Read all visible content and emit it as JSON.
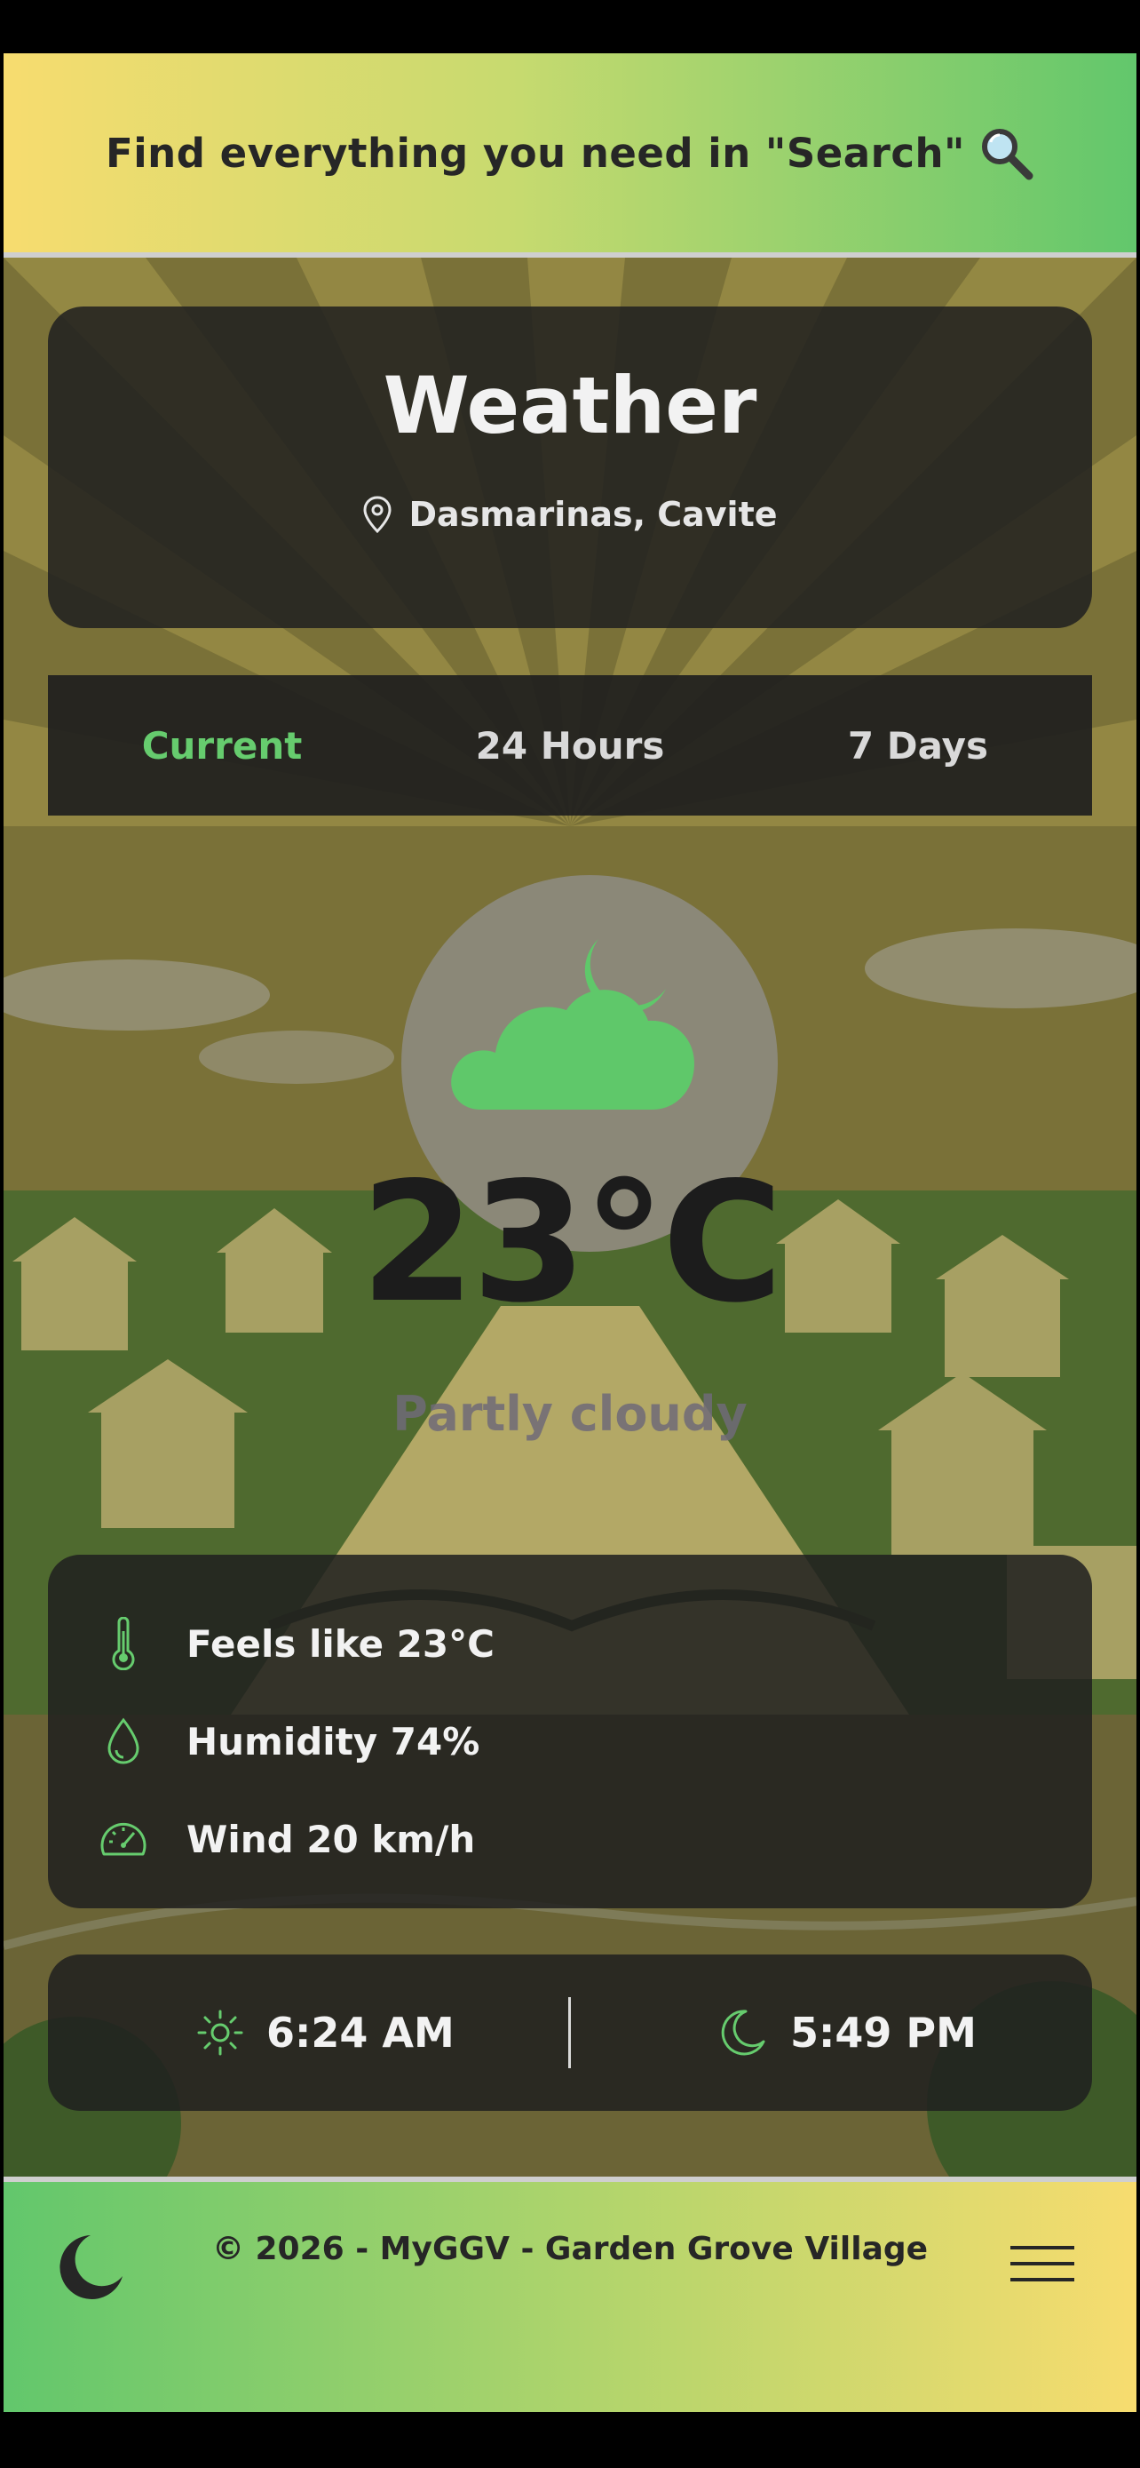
{
  "banner": {
    "text": "Find everything you need in \"Search\"",
    "icon": "magnifier-icon"
  },
  "header": {
    "title": "Weather",
    "location": "Dasmarinas, Cavite",
    "location_icon": "map-pin-icon"
  },
  "tabs": [
    {
      "label": "Current",
      "active": true
    },
    {
      "label": "24 Hours",
      "active": false
    },
    {
      "label": "7 Days",
      "active": false
    }
  ],
  "current": {
    "icon": "cloud-moon-icon",
    "temperature": "23°C",
    "condition": "Partly cloudy"
  },
  "details": [
    {
      "icon": "thermometer-icon",
      "text": "Feels like 23°C"
    },
    {
      "icon": "droplet-icon",
      "text": "Humidity 74%"
    },
    {
      "icon": "speedometer-icon",
      "text": "Wind 20 km/h"
    }
  ],
  "sun": {
    "sunrise": "6:24 AM",
    "sunrise_icon": "sun-icon",
    "sunset": "5:49 PM",
    "sunset_icon": "moon-icon"
  },
  "footer": {
    "text": "© 2026 - MyGGV - Garden Grove Village",
    "theme_icon": "moon-icon",
    "menu_icon": "hamburger-menu-icon"
  },
  "colors": {
    "accent_green": "#66cc6e",
    "banner_yellow": "#f7dc6f",
    "card_dark": "#202020"
  }
}
